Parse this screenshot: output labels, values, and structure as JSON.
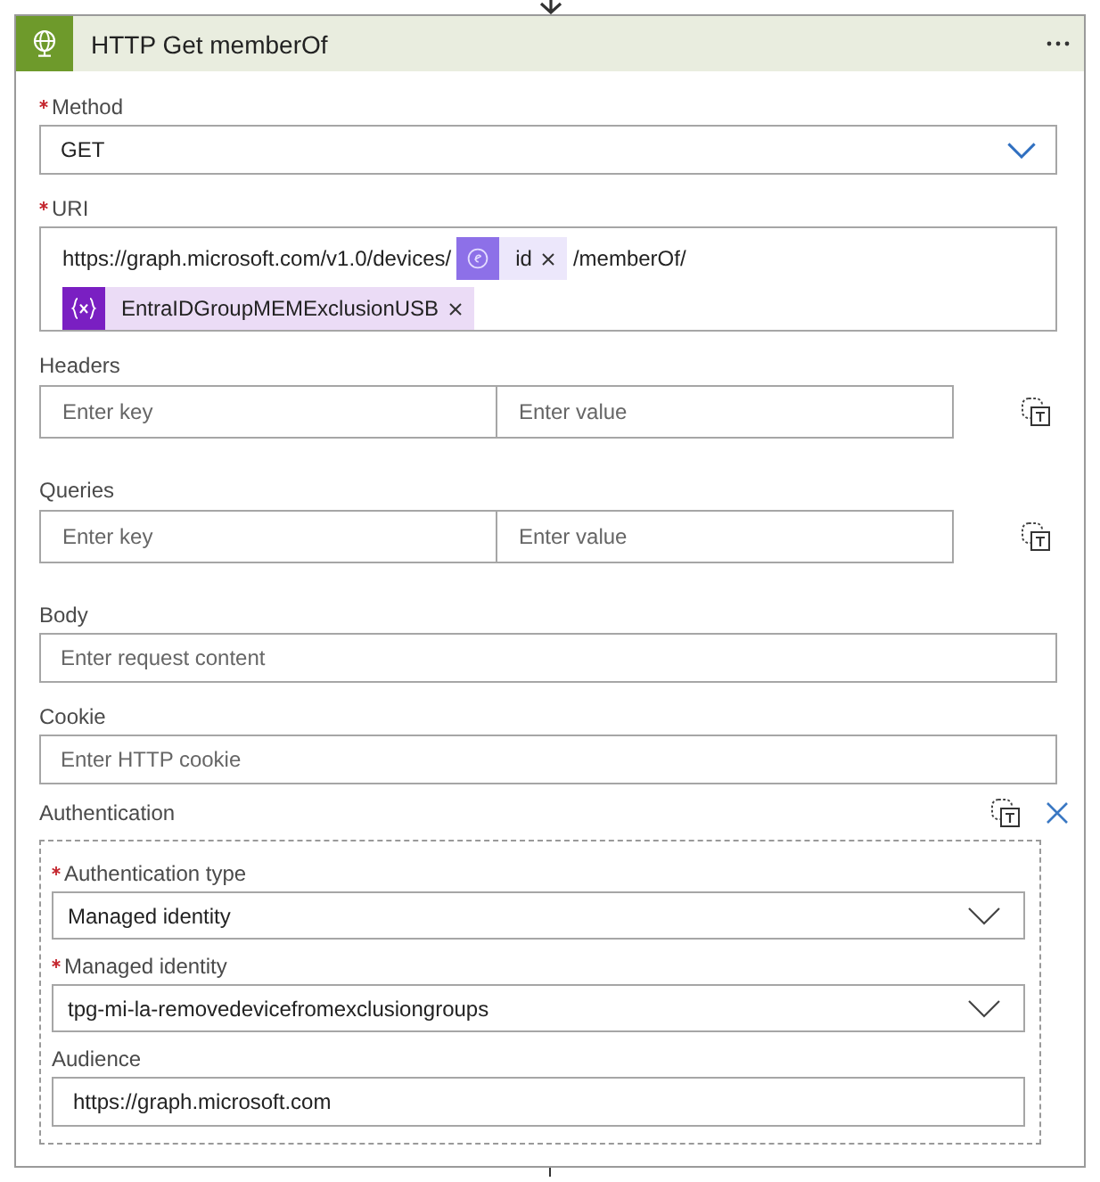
{
  "card": {
    "title": "HTTP Get memberOf"
  },
  "fields": [
    {
      "kind": "dropdown",
      "label": "Method",
      "required": true,
      "value": "GET"
    },
    {
      "kind": "tokens",
      "label": "URI",
      "required": true,
      "parts": [
        {
          "kind": "text",
          "text": "https://graph.microsoft.com/v1.0/devices/"
        },
        {
          "kind": "output",
          "text": "id"
        },
        {
          "kind": "text",
          "text": "/memberOf/"
        },
        {
          "kind": "variable",
          "text": "EntraIDGroupMEMExclusionUSB"
        }
      ]
    },
    {
      "kind": "key_value",
      "label": "Headers",
      "required": false,
      "key_placeholder": "Enter key",
      "value_placeholder": "Enter value"
    },
    {
      "kind": "key_value",
      "label": "Queries",
      "required": false,
      "key_placeholder": "Enter key",
      "value_placeholder": "Enter value"
    },
    {
      "kind": "text",
      "label": "Body",
      "required": false,
      "placeholder": "Enter request content"
    },
    {
      "kind": "text",
      "label": "Cookie",
      "required": false,
      "placeholder": "Enter HTTP cookie"
    },
    {
      "kind": "group",
      "label": "Authentication",
      "required": false,
      "fields": [
        {
          "kind": "dropdown",
          "label": "Authentication type",
          "required": true,
          "value": "Managed identity"
        },
        {
          "kind": "dropdown",
          "label": "Managed identity",
          "required": true,
          "value": "tpg-mi-la-removedevicefromexclusiongroups"
        },
        {
          "kind": "text",
          "label": "Audience",
          "required": false,
          "value": "https://graph.microsoft.com"
        }
      ]
    }
  ]
}
